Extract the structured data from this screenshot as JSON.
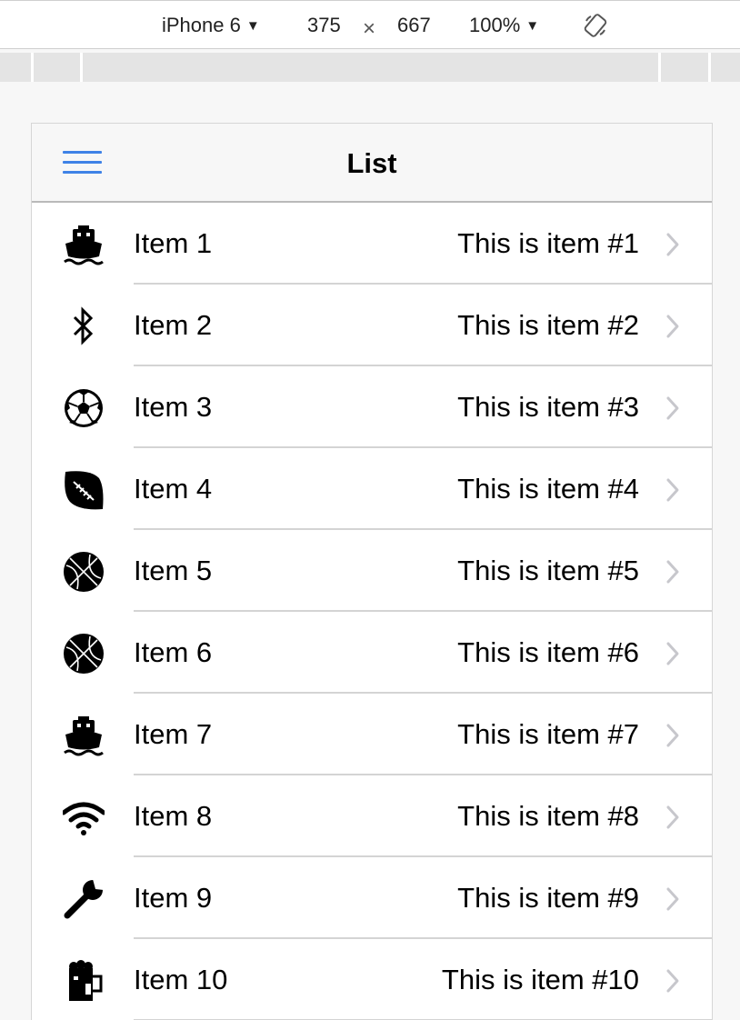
{
  "device_toolbar": {
    "device": "iPhone 6",
    "width": "375",
    "times": "×",
    "height": "667",
    "zoom": "100%"
  },
  "navbar": {
    "title": "List"
  },
  "list": {
    "items": [
      {
        "icon": "ship-icon",
        "label": "Item 1",
        "detail": "This is item #1"
      },
      {
        "icon": "bluetooth-icon",
        "label": "Item 2",
        "detail": "This is item #2"
      },
      {
        "icon": "soccer-ball-icon",
        "label": "Item 3",
        "detail": "This is item #3"
      },
      {
        "icon": "american-football-icon",
        "label": "Item 4",
        "detail": "This is item #4"
      },
      {
        "icon": "basketball-icon",
        "label": "Item 5",
        "detail": "This is item #5"
      },
      {
        "icon": "basketball-icon",
        "label": "Item 6",
        "detail": "This is item #6"
      },
      {
        "icon": "ship-icon",
        "label": "Item 7",
        "detail": "This is item #7"
      },
      {
        "icon": "wifi-icon",
        "label": "Item 8",
        "detail": "This is item #8"
      },
      {
        "icon": "wrench-icon",
        "label": "Item 9",
        "detail": "This is item #9"
      },
      {
        "icon": "beer-mug-icon",
        "label": "Item 10",
        "detail": "This is item #10"
      }
    ]
  },
  "colors": {
    "accent": "#3f82e6",
    "chevron": "#c7c7cc",
    "separator": "#d4d4d4"
  }
}
